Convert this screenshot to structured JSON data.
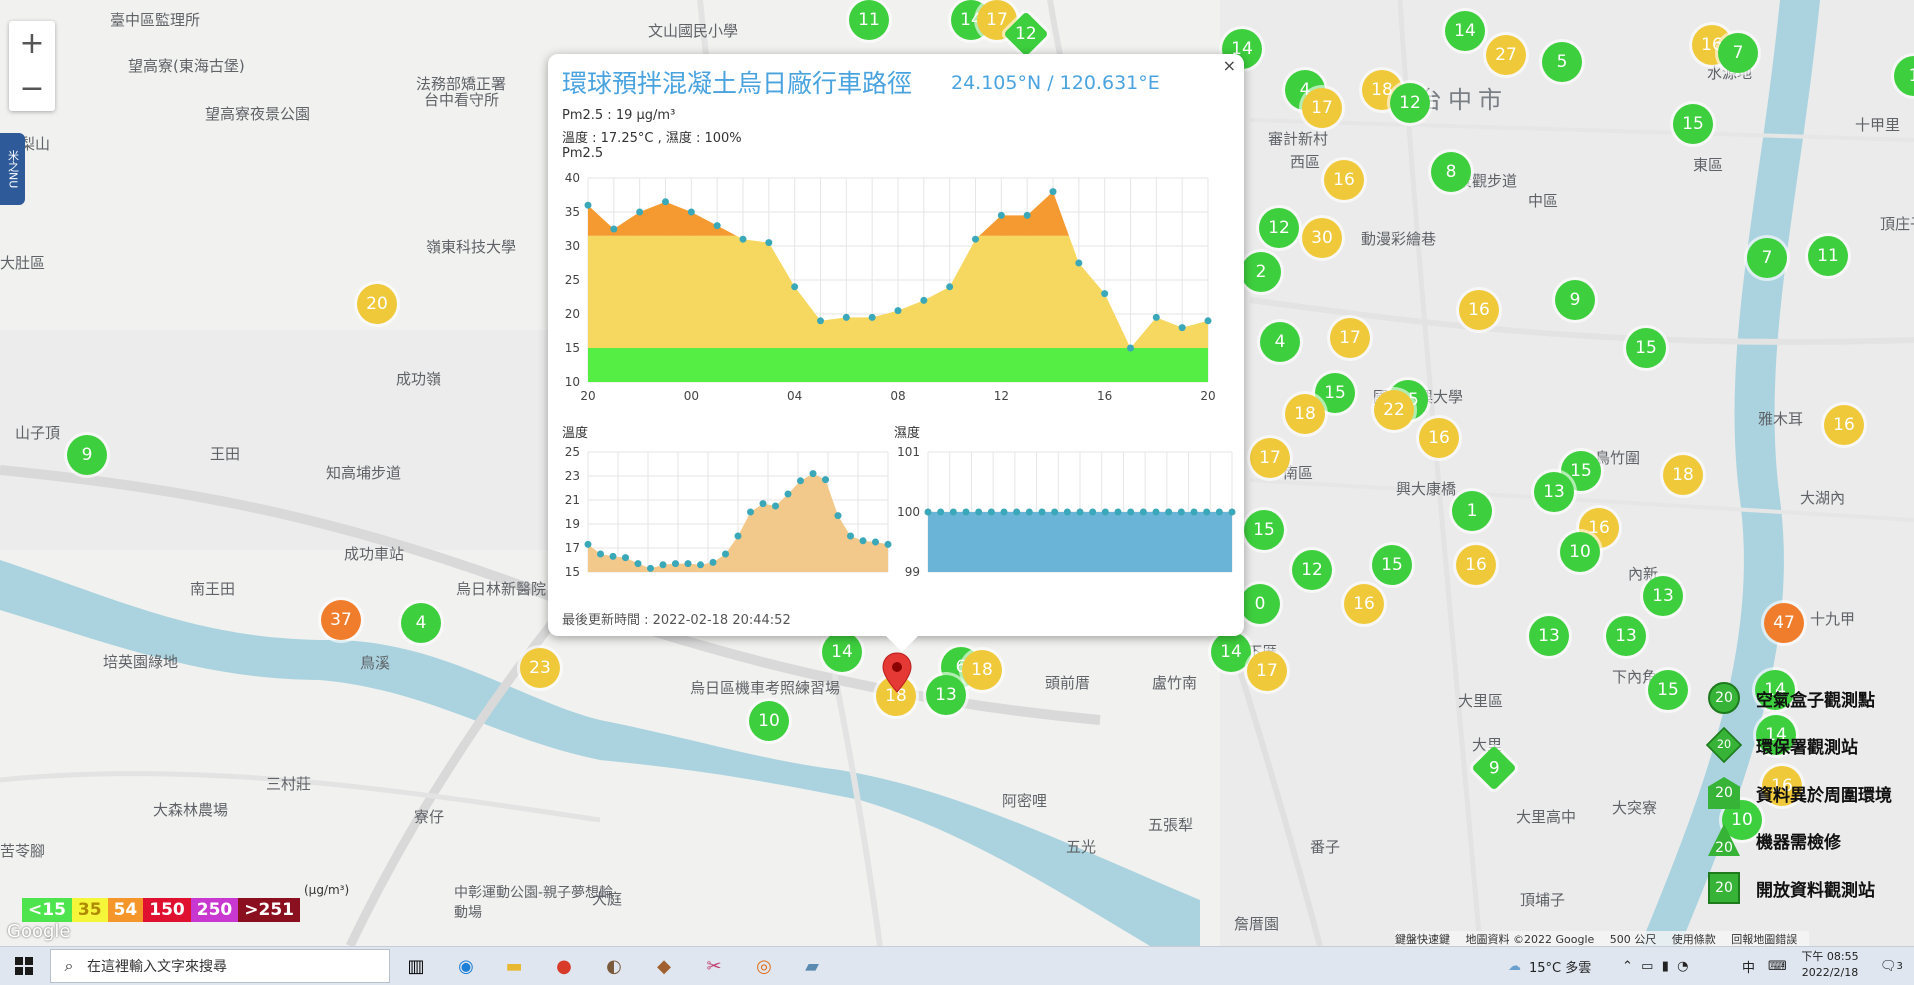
{
  "map": {
    "places": [
      {
        "text": "臺中區監理所"
      },
      {
        "text": "文山國民小學"
      },
      {
        "text": "望高寮(東海古堡)"
      },
      {
        "text": "法務部矯正署"
      },
      {
        "text": "台中看守所"
      },
      {
        "text": "望高寮夜景公園"
      },
      {
        "text": "梨山"
      },
      {
        "text": "嶺東科技大學"
      },
      {
        "text": "大肚區"
      },
      {
        "text": "成功嶺"
      },
      {
        "text": "山子頂"
      },
      {
        "text": "王田"
      },
      {
        "text": "知高埔步道"
      },
      {
        "text": "成功車站"
      },
      {
        "text": "烏日林新醫院"
      },
      {
        "text": "南王田"
      },
      {
        "text": "培英園綠地"
      },
      {
        "text": "三村莊"
      },
      {
        "text": "大森林農場"
      },
      {
        "text": "寮仔"
      },
      {
        "text": "苦苓腳"
      },
      {
        "text": "中彰運動公園-親子夢想輪動場"
      },
      {
        "text": "大庭"
      },
      {
        "text": "烏日區機車考照練習場"
      },
      {
        "text": "阿密哩"
      },
      {
        "text": "五光"
      },
      {
        "text": "五張犁"
      },
      {
        "text": "頭前厝"
      },
      {
        "text": "盧竹南"
      },
      {
        "text": "下厝"
      },
      {
        "text": "番子"
      },
      {
        "text": "大里區"
      },
      {
        "text": "台中市"
      },
      {
        "text": "審計新村"
      },
      {
        "text": "西區"
      },
      {
        "text": "中區"
      },
      {
        "text": "東區"
      },
      {
        "text": "南區"
      },
      {
        "text": "大里"
      },
      {
        "text": "大里高中"
      },
      {
        "text": "頂埔子"
      },
      {
        "text": "大突寮"
      },
      {
        "text": "鳥竹圍"
      },
      {
        "text": "大湖內"
      },
      {
        "text": "十九甲"
      },
      {
        "text": "內新"
      },
      {
        "text": "下內角"
      },
      {
        "text": "雅木耳"
      },
      {
        "text": "十甲里"
      },
      {
        "text": "水源地"
      },
      {
        "text": "頂庄子"
      },
      {
        "text": "鳥溪"
      },
      {
        "text": "詹厝園"
      },
      {
        "text": "國立中興大學"
      },
      {
        "text": "興大康橋"
      },
      {
        "text": "動漫彩繪巷"
      },
      {
        "text": "岸景觀步道"
      }
    ],
    "markers": [
      {
        "v": "11",
        "c": "#3ecf3e"
      },
      {
        "v": "14",
        "c": "#3ecf3e"
      },
      {
        "v": "17",
        "c": "#f0c93a"
      },
      {
        "v": "12",
        "c": "#3ecf3e",
        "shape": "diamond"
      },
      {
        "v": "14",
        "c": "#3ecf3e"
      },
      {
        "v": "14",
        "c": "#3ecf3e"
      },
      {
        "v": "27",
        "c": "#f0c93a"
      },
      {
        "v": "5",
        "c": "#3ecf3e"
      },
      {
        "v": "16",
        "c": "#f0c93a"
      },
      {
        "v": "7",
        "c": "#3ecf3e"
      },
      {
        "v": "4",
        "c": "#3ecf3e"
      },
      {
        "v": "17",
        "c": "#f0c93a"
      },
      {
        "v": "18",
        "c": "#f0c93a"
      },
      {
        "v": "12",
        "c": "#3ecf3e"
      },
      {
        "v": "15",
        "c": "#3ecf3e"
      },
      {
        "v": "16",
        "c": "#f0c93a"
      },
      {
        "v": "8",
        "c": "#3ecf3e"
      },
      {
        "v": "12",
        "c": "#3ecf3e"
      },
      {
        "v": "30",
        "c": "#f0c93a"
      },
      {
        "v": "2",
        "c": "#3ecf3e"
      },
      {
        "v": "7",
        "c": "#3ecf3e"
      },
      {
        "v": "11",
        "c": "#3ecf3e"
      },
      {
        "v": "9",
        "c": "#3ecf3e"
      },
      {
        "v": "16",
        "c": "#f0c93a"
      },
      {
        "v": "4",
        "c": "#3ecf3e"
      },
      {
        "v": "17",
        "c": "#f0c93a"
      },
      {
        "v": "15",
        "c": "#3ecf3e"
      },
      {
        "v": "15",
        "c": "#3ecf3e"
      },
      {
        "v": "15",
        "c": "#3ecf3e"
      },
      {
        "v": "22",
        "c": "#f0c93a"
      },
      {
        "v": "18",
        "c": "#f0c93a"
      },
      {
        "v": "16",
        "c": "#f0c93a"
      },
      {
        "v": "17",
        "c": "#f0c93a"
      },
      {
        "v": "16",
        "c": "#f0c93a"
      },
      {
        "v": "18",
        "c": "#f0c93a"
      },
      {
        "v": "15",
        "c": "#3ecf3e"
      },
      {
        "v": "13",
        "c": "#3ecf3e"
      },
      {
        "v": "1",
        "c": "#3ecf3e"
      },
      {
        "v": "16",
        "c": "#f0c93a"
      },
      {
        "v": "10",
        "c": "#3ecf3e"
      },
      {
        "v": "15",
        "c": "#3ecf3e"
      },
      {
        "v": "12",
        "c": "#3ecf3e"
      },
      {
        "v": "15",
        "c": "#3ecf3e"
      },
      {
        "v": "16",
        "c": "#f0c93a"
      },
      {
        "v": "0",
        "c": "#3ecf3e"
      },
      {
        "v": "16",
        "c": "#f0c93a"
      },
      {
        "v": "13",
        "c": "#3ecf3e"
      },
      {
        "v": "47",
        "c": "#f07d2c"
      },
      {
        "v": "13",
        "c": "#3ecf3e"
      },
      {
        "v": "13",
        "c": "#3ecf3e"
      },
      {
        "v": "14",
        "c": "#3ecf3e"
      },
      {
        "v": "17",
        "c": "#f0c93a"
      },
      {
        "v": "20",
        "c": "#f0c93a"
      },
      {
        "v": "9",
        "c": "#3ecf3e"
      },
      {
        "v": "37",
        "c": "#f07d2c"
      },
      {
        "v": "4",
        "c": "#3ecf3e"
      },
      {
        "v": "23",
        "c": "#f0c93a"
      },
      {
        "v": "14",
        "c": "#3ecf3e"
      },
      {
        "v": "6",
        "c": "#3ecf3e"
      },
      {
        "v": "18",
        "c": "#f0c93a"
      },
      {
        "v": "18",
        "c": "#f0c93a"
      },
      {
        "v": "13",
        "c": "#3ecf3e"
      },
      {
        "v": "10",
        "c": "#3ecf3e"
      },
      {
        "v": "9",
        "c": "#3ecf3e",
        "shape": "diamond"
      },
      {
        "v": "15",
        "c": "#3ecf3e"
      },
      {
        "v": "14",
        "c": "#3ecf3e"
      },
      {
        "v": "10",
        "c": "#3ecf3e"
      },
      {
        "v": "16",
        "c": "#f0c93a"
      },
      {
        "v": "14",
        "c": "#3ecf3e"
      },
      {
        "v": "1",
        "c": "#3ecf3e"
      }
    ]
  },
  "zoom": {
    "in": "+",
    "out": "−"
  },
  "side_tab": "米之NU",
  "popup": {
    "title": "環球預拌混凝土烏日廠行車路徑",
    "coord": "24.105°N / 120.631°E",
    "close": "×",
    "pm25_line": "Pm2.5 : 19 μg/m³",
    "temp_line": "溫度 : 17.25°C , 濕度 : 100%",
    "pm25_label": "Pm2.5",
    "temp_label": "溫度",
    "hum_label": "濕度",
    "updated": "最後更新時間 : 2022-02-18 20:44:52"
  },
  "chart_data": [
    {
      "type": "area",
      "title": "Pm2.5",
      "x": [
        "20",
        "21",
        "22",
        "23",
        "00",
        "01",
        "02",
        "03",
        "04",
        "05",
        "06",
        "07",
        "08",
        "09",
        "10",
        "11",
        "12",
        "13",
        "14",
        "15",
        "16",
        "17",
        "18",
        "19",
        "20"
      ],
      "xticks": [
        "20",
        "00",
        "04",
        "08",
        "12",
        "16",
        "20"
      ],
      "yticks": [
        "10",
        "15",
        "20",
        "25",
        "30",
        "35",
        "40"
      ],
      "ylim": [
        10,
        40
      ],
      "values": [
        36,
        32.5,
        35,
        36.5,
        35,
        33,
        31,
        30.5,
        24,
        19,
        19.5,
        19.5,
        20.5,
        22,
        24,
        31,
        34.5,
        34.5,
        38,
        27.5,
        23,
        15,
        19.5,
        18,
        19
      ]
    },
    {
      "type": "area",
      "title": "溫度",
      "yticks": [
        "15",
        "17",
        "19",
        "21",
        "23",
        "25"
      ],
      "ylim": [
        15,
        25
      ],
      "values": [
        17.3,
        16.5,
        16.3,
        16.2,
        15.7,
        15.3,
        15.6,
        15.7,
        15.7,
        15.6,
        15.8,
        16.5,
        18,
        20,
        20.7,
        20.5,
        21.5,
        22.6,
        23.2,
        22.7,
        19.7,
        18,
        17.6,
        17.5,
        17.3
      ]
    },
    {
      "type": "area",
      "title": "濕度",
      "yticks": [
        "99",
        "100",
        "101"
      ],
      "ylim": [
        99,
        101
      ],
      "values": [
        100,
        100,
        100,
        100,
        100,
        100,
        100,
        100,
        100,
        100,
        100,
        100,
        100,
        100,
        100,
        100,
        100,
        100,
        100,
        100,
        100,
        100,
        100,
        100,
        100
      ]
    }
  ],
  "legend": [
    {
      "icon": "circle",
      "value": "20",
      "label": "空氣盒子觀測點"
    },
    {
      "icon": "diamond",
      "value": "20",
      "label": "環保署觀測站"
    },
    {
      "icon": "pentagon",
      "value": "20",
      "label": "資料異於周圍環境"
    },
    {
      "icon": "triangle",
      "value": "20",
      "label": "機器需檢修"
    },
    {
      "icon": "square",
      "value": "20",
      "label": "開放資料觀測站"
    }
  ],
  "scale": {
    "unit": "(μg/m³)",
    "cells": [
      {
        "label": "<15",
        "bg": "#4ee44e",
        "fg": "#ffffff"
      },
      {
        "label": "35",
        "bg": "#f5f53a",
        "fg": "#b08a00"
      },
      {
        "label": "54",
        "bg": "#f5962a",
        "fg": "#ffffff"
      },
      {
        "label": "150",
        "bg": "#e01030",
        "fg": "#ffffff"
      },
      {
        "label": "250",
        "bg": "#c837d0",
        "fg": "#ffffff"
      },
      {
        "label": ">251",
        "bg": "#8a1020",
        "fg": "#ffffff"
      }
    ]
  },
  "google_logo": "Google",
  "attribution": {
    "shortcuts": "鍵盤快速鍵",
    "mapdata": "地圖資料 ©2022 Google",
    "scale": "500 公尺",
    "terms": "使用條款",
    "report": "回報地圖錯誤"
  },
  "taskbar": {
    "search_placeholder": "在這裡輸入文字來搜尋",
    "weather": "15°C 多雲",
    "ime": "中",
    "time": "下午 08:55",
    "date": "2022/2/18",
    "notifications": "3"
  }
}
